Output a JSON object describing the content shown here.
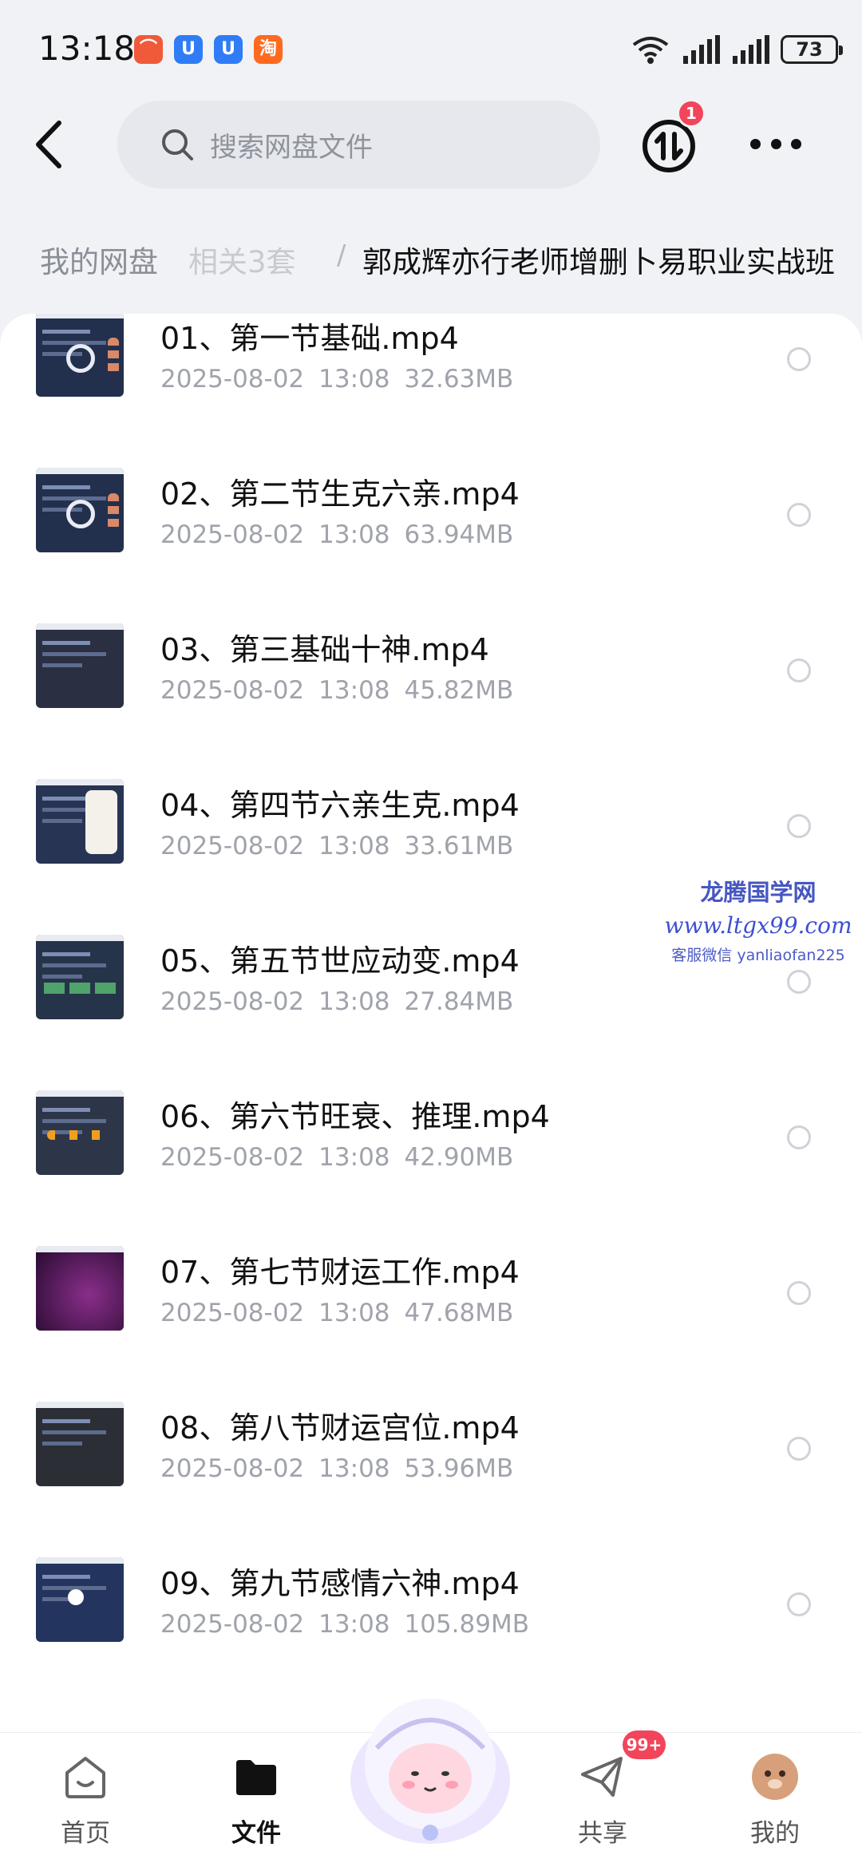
{
  "status_bar": {
    "time": "13:18",
    "app_badges": [
      {
        "name": "meituan-app-icon",
        "glyph": "⌒",
        "color": "#f05a3a"
      },
      {
        "name": "u-app-icon-1",
        "glyph": "U",
        "color": "#2f7cf6"
      },
      {
        "name": "u-app-icon-2",
        "glyph": "U",
        "color": "#2f7cf6"
      },
      {
        "name": "taobao-app-icon",
        "glyph": "淘",
        "color": "#ff6a1f"
      }
    ],
    "battery": "73"
  },
  "header": {
    "search_placeholder": "搜索网盘文件",
    "transfer_badge": "1"
  },
  "breadcrumb": {
    "root": "我的网盘",
    "parent": "相关3套",
    "separator": "/",
    "current": "郭成辉亦行老师增删卜易职业实战班"
  },
  "files": [
    {
      "name": "01、第一节基础.mp4",
      "date": "2025-08-02",
      "time": "13:08",
      "size": "32.63MB",
      "thumb": "blue-circle"
    },
    {
      "name": "02、第二节生克六亲.mp4",
      "date": "2025-08-02",
      "time": "13:08",
      "size": "63.94MB",
      "thumb": "blue-circle"
    },
    {
      "name": "03、第三基础十神.mp4",
      "date": "2025-08-02",
      "time": "13:08",
      "size": "45.82MB",
      "thumb": "dark"
    },
    {
      "name": "04、第四节六亲生克.mp4",
      "date": "2025-08-02",
      "time": "13:08",
      "size": "33.61MB",
      "thumb": "hand"
    },
    {
      "name": "05、第五节世应动变.mp4",
      "date": "2025-08-02",
      "time": "13:08",
      "size": "27.84MB",
      "thumb": "boxes"
    },
    {
      "name": "06、第六节旺衰、推理.mp4",
      "date": "2025-08-02",
      "time": "13:08",
      "size": "42.90MB",
      "thumb": "pins"
    },
    {
      "name": "07、第七节财运工作.mp4",
      "date": "2025-08-02",
      "time": "13:08",
      "size": "47.68MB",
      "thumb": "purple"
    },
    {
      "name": "08、第八节财运宫位.mp4",
      "date": "2025-08-02",
      "time": "13:08",
      "size": "53.96MB",
      "thumb": "dark-split"
    },
    {
      "name": "09、第九节感情六神.mp4",
      "date": "2025-08-02",
      "time": "13:08",
      "size": "105.89MB",
      "thumb": "blue-list"
    }
  ],
  "watermark": {
    "title": "龙腾国学网",
    "url": "www.ltgx99.com",
    "contact": "客服微信 yanliaofan225"
  },
  "bottom_nav": {
    "home": "首页",
    "files": "文件",
    "share": "共享",
    "share_badge": "99+",
    "me": "我的"
  },
  "colors": {
    "accent_red": "#f2445a",
    "background": "#f1f2f6",
    "watermark_blue": "#4657c2"
  }
}
